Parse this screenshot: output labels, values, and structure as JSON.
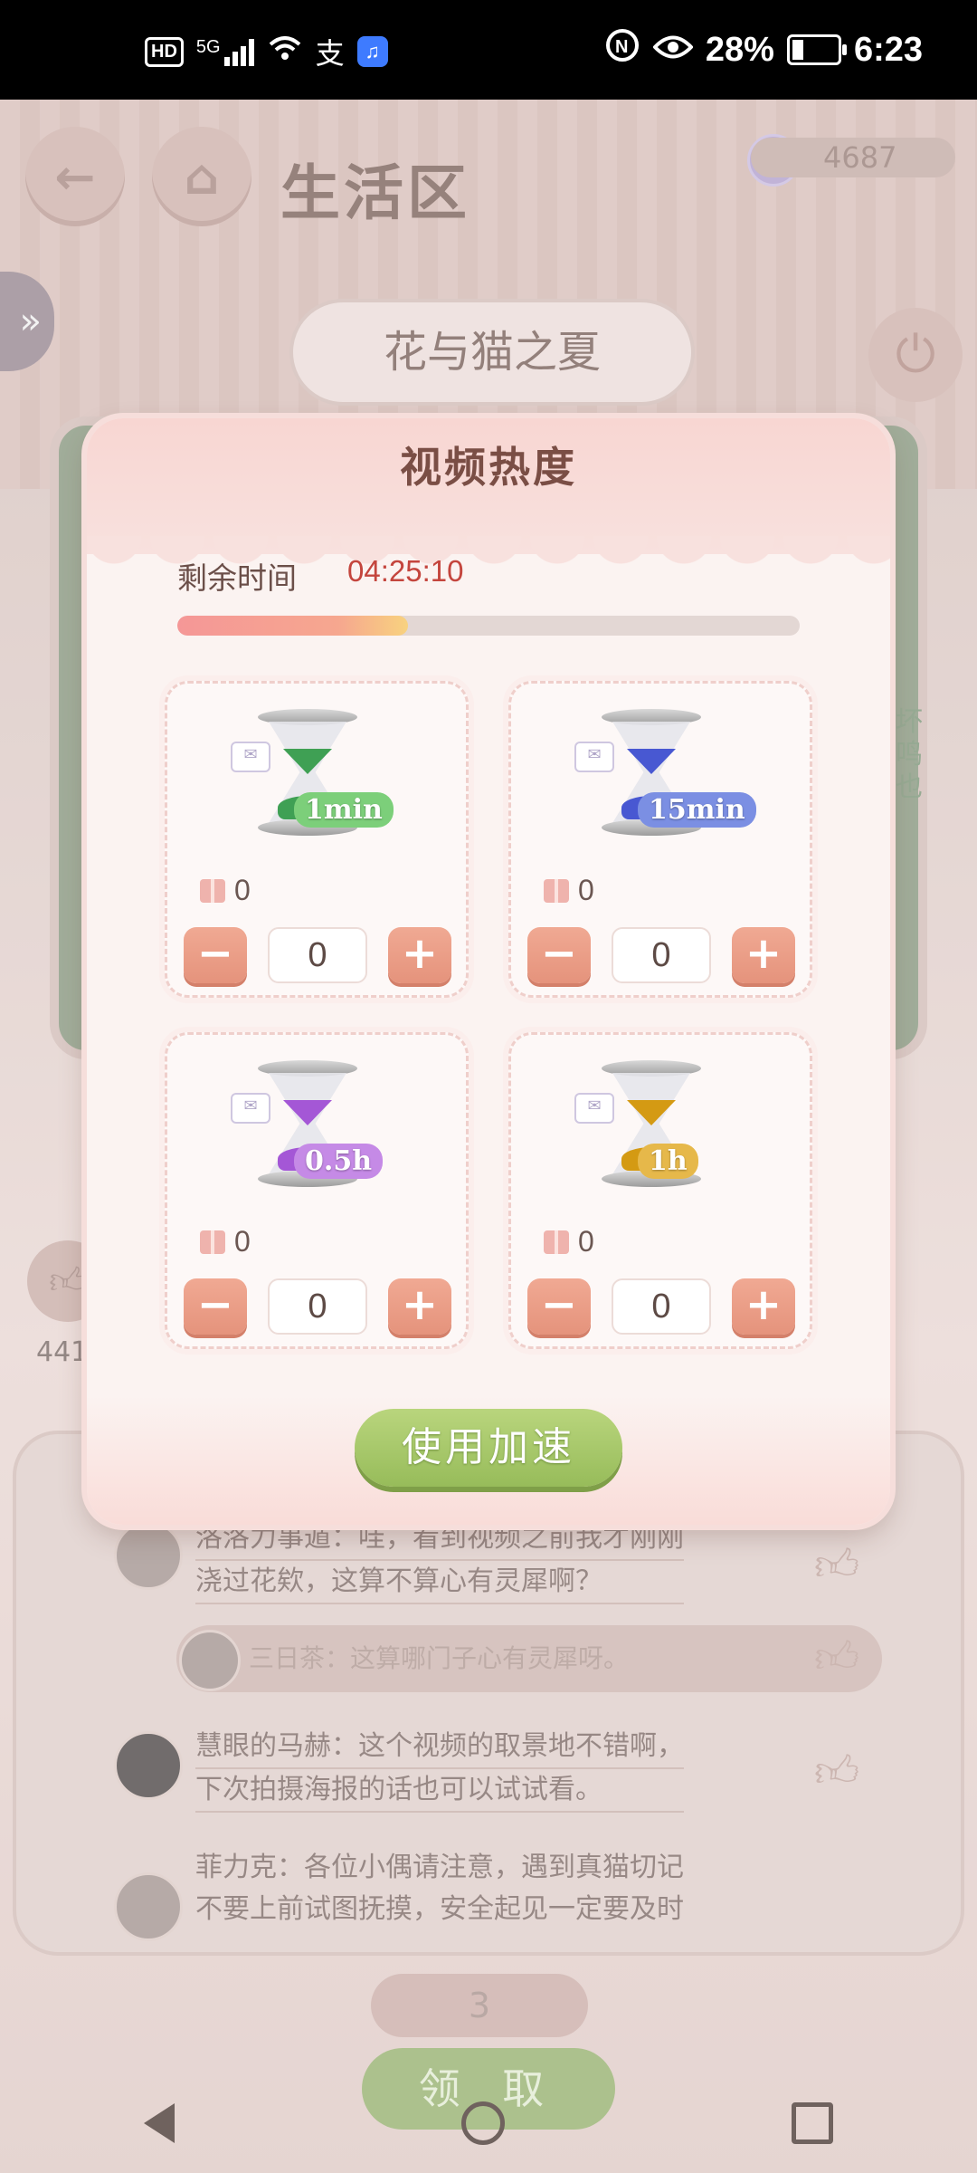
{
  "status_bar": {
    "left_icons": [
      "hd-icon",
      "5g-signal-icon",
      "wifi-icon",
      "alipay-icon",
      "music-app-icon"
    ],
    "hd_label": "HD",
    "network": "5G",
    "alipay_glyph": "支",
    "battery_percent": "28%",
    "time": "6:23"
  },
  "background": {
    "page_title": "生活区",
    "currency_amount": "4687",
    "video_title": "花与猫之夏",
    "side_text": "坏鸣也",
    "like_count": "441",
    "comments": [
      {
        "line1": "洛洛力事遁：哇，看到视频之前我才刚刚",
        "line2": "浇过花欸，这算不算心有灵犀啊？"
      },
      {
        "reply": "三日茶：这算哪门子心有灵犀呀。"
      },
      {
        "line1": "慧眼的马赫：这个视频的取景地不错啊，",
        "line2": "下次拍摄海报的话也可以试试看。"
      },
      {
        "line1": "菲力克：各位小偶请注意，遇到真猫切记",
        "line2": "不要上前试图抚摸，安全起见一定要及时"
      }
    ],
    "claim_counter": "3",
    "claim_button": "领 取"
  },
  "modal": {
    "title": "视频热度",
    "remaining_label": "剩余时间",
    "remaining_value": "04:25:10",
    "progress_fraction": 0.37,
    "items": [
      {
        "badge": "1min",
        "owned": "0",
        "qty": "0",
        "color": "#7ccf7a",
        "sand": "#3fa054"
      },
      {
        "badge": "15min",
        "owned": "0",
        "qty": "0",
        "color": "#7b8fe3",
        "sand": "#4858d2"
      },
      {
        "badge": "0.5h",
        "owned": "0",
        "qty": "0",
        "color": "#c58ae6",
        "sand": "#a457d6"
      },
      {
        "badge": "1h",
        "owned": "0",
        "qty": "0",
        "color": "#e6b84a",
        "sand": "#d49a13"
      }
    ],
    "minus": "−",
    "plus": "+",
    "use_button": "使用加速"
  }
}
